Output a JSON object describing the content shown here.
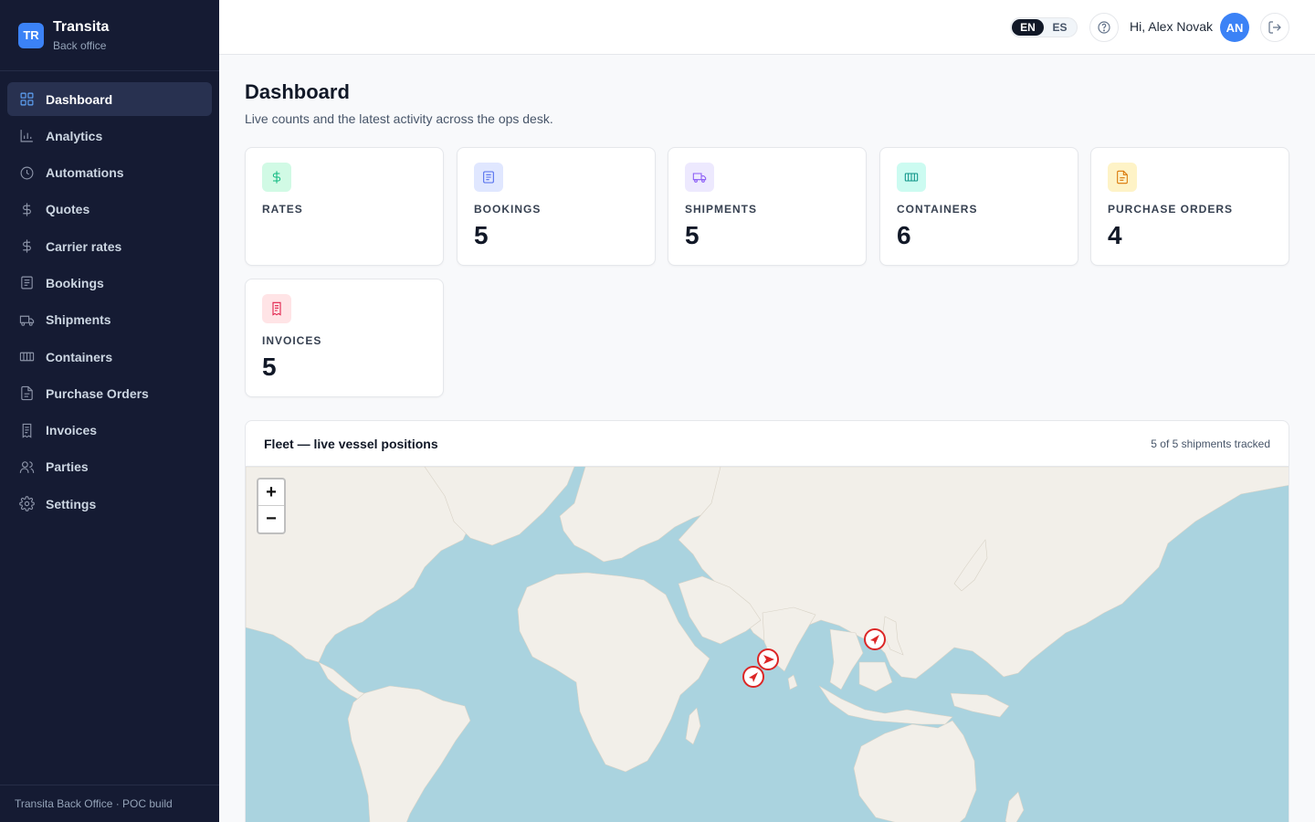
{
  "brand": {
    "logo": "TR",
    "name": "Transita",
    "subtitle": "Back office"
  },
  "sidebar": {
    "items": [
      {
        "label": "Dashboard",
        "icon": "grid-icon",
        "active": true
      },
      {
        "label": "Analytics",
        "icon": "bar-chart-icon"
      },
      {
        "label": "Automations",
        "icon": "clock-icon"
      },
      {
        "label": "Quotes",
        "icon": "dollar-icon"
      },
      {
        "label": "Carrier rates",
        "icon": "dollar-icon"
      },
      {
        "label": "Bookings",
        "icon": "document-icon"
      },
      {
        "label": "Shipments",
        "icon": "truck-icon"
      },
      {
        "label": "Containers",
        "icon": "container-icon"
      },
      {
        "label": "Purchase Orders",
        "icon": "file-icon"
      },
      {
        "label": "Invoices",
        "icon": "receipt-icon"
      },
      {
        "label": "Parties",
        "icon": "users-icon"
      },
      {
        "label": "Settings",
        "icon": "gear-icon"
      }
    ],
    "footer": "Transita Back Office · POC build"
  },
  "header": {
    "lang": {
      "en": "EN",
      "es": "ES",
      "selected": "EN"
    },
    "greeting": "Hi, Alex Novak",
    "avatar": "AN"
  },
  "main": {
    "title": "Dashboard",
    "subtitle": "Live counts and the latest activity across the ops desk.",
    "cards": [
      {
        "label": "RATES",
        "value": "",
        "icon": "dollar-icon",
        "color": "#10b981",
        "bg": "#d1fae5"
      },
      {
        "label": "BOOKINGS",
        "value": "5",
        "icon": "document-icon",
        "color": "#4f6bed",
        "bg": "#e0e7ff"
      },
      {
        "label": "SHIPMENTS",
        "value": "5",
        "icon": "truck-icon",
        "color": "#8b5cf6",
        "bg": "#ede9fe"
      },
      {
        "label": "CONTAINERS",
        "value": "6",
        "icon": "container-icon",
        "color": "#0d9488",
        "bg": "#ccfbf1"
      },
      {
        "label": "PURCHASE ORDERS",
        "value": "4",
        "icon": "file-icon",
        "color": "#d97706",
        "bg": "#fef3c7"
      },
      {
        "label": "INVOICES",
        "value": "5",
        "icon": "receipt-icon",
        "color": "#e11d48",
        "bg": "#ffe4e6"
      }
    ],
    "fleet": {
      "title": "Fleet — live vessel positions",
      "count": "5 of 5 shipments tracked",
      "zoom_in": "+",
      "zoom_out": "−"
    }
  },
  "colors": {
    "sidebar": "#151b33",
    "accent": "#3b82f6",
    "ocean": "#aad3df",
    "land": "#f2efe9",
    "marker": "#dc2626"
  }
}
